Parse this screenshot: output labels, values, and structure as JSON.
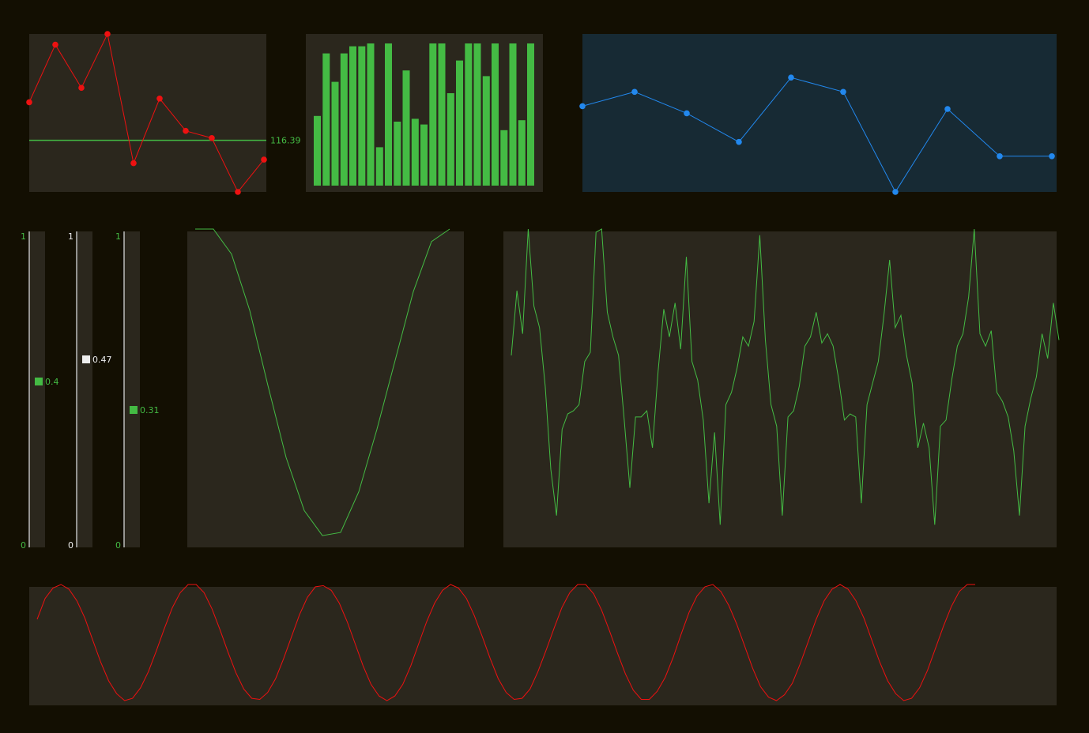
{
  "colors": {
    "background": "#130f02",
    "panel": "#2b271d",
    "panel_blue": "#172a34",
    "green": "#44bb44",
    "red": "#ee1111",
    "blue": "#2288ee",
    "white": "#eeeeee",
    "slider_track": "#bbbbbb"
  },
  "chart_data": [
    {
      "type": "line",
      "id": "red-markers",
      "x": [
        0,
        1,
        2,
        3,
        4,
        5,
        6,
        7,
        8,
        9
      ],
      "values": [
        127,
        143,
        131,
        146,
        110,
        128,
        119,
        117,
        102,
        111
      ],
      "ylim": [
        102,
        146
      ],
      "markers": true,
      "reference_line": {
        "value": 116.39,
        "label": "116.39"
      }
    },
    {
      "type": "bar",
      "id": "green-bars",
      "values": [
        0.49,
        0.93,
        0.73,
        0.93,
        0.98,
        0.98,
        1.0,
        0.27,
        1.0,
        0.45,
        0.81,
        0.47,
        0.43,
        1.0,
        1.0,
        0.65,
        0.88,
        1.0,
        1.0,
        0.77,
        1.0,
        0.39,
        1.0,
        0.46,
        1.0
      ],
      "ylim": [
        0,
        1
      ]
    },
    {
      "type": "line",
      "id": "blue-markers",
      "x": [
        0,
        1,
        2,
        3,
        4,
        5,
        6,
        7,
        8,
        9
      ],
      "values": [
        0.6,
        0.7,
        0.55,
        0.35,
        0.8,
        0.7,
        0.0,
        0.58,
        0.25,
        0.25
      ],
      "ylim": [
        0,
        1
      ],
      "markers": true
    },
    {
      "type": "line",
      "id": "valley-curve",
      "x": [
        0,
        1,
        2,
        3,
        4,
        5,
        6,
        7,
        8,
        9,
        10,
        11,
        12,
        13,
        14
      ],
      "values": [
        1.0,
        1.0,
        0.92,
        0.74,
        0.5,
        0.27,
        0.1,
        0.02,
        0.03,
        0.16,
        0.36,
        0.58,
        0.8,
        0.96,
        1.0
      ],
      "ylim": [
        0,
        1
      ]
    },
    {
      "type": "line",
      "id": "noisy-signal",
      "values": [
        0.59,
        0.8,
        0.66,
        1.0,
        0.75,
        0.68,
        0.49,
        0.22,
        0.07,
        0.35,
        0.4,
        0.41,
        0.43,
        0.57,
        0.6,
        0.99,
        1.0,
        0.73,
        0.65,
        0.59,
        0.38,
        0.16,
        0.39,
        0.39,
        0.41,
        0.29,
        0.54,
        0.74,
        0.65,
        0.76,
        0.61,
        0.91,
        0.57,
        0.51,
        0.38,
        0.11,
        0.34,
        0.04,
        0.43,
        0.47,
        0.55,
        0.65,
        0.62,
        0.7,
        0.98,
        0.64,
        0.43,
        0.36,
        0.07,
        0.39,
        0.41,
        0.49,
        0.62,
        0.65,
        0.73,
        0.63,
        0.66,
        0.62,
        0.51,
        0.38,
        0.4,
        0.39,
        0.11,
        0.43,
        0.5,
        0.57,
        0.72,
        0.9,
        0.68,
        0.72,
        0.59,
        0.5,
        0.29,
        0.37,
        0.29,
        0.04,
        0.36,
        0.38,
        0.51,
        0.62,
        0.66,
        0.78,
        1.0,
        0.66,
        0.62,
        0.67,
        0.47,
        0.44,
        0.39,
        0.28,
        0.07,
        0.36,
        0.45,
        0.52,
        0.66,
        0.58,
        0.76,
        0.64
      ],
      "ylim": [
        0,
        1
      ]
    },
    {
      "type": "line",
      "id": "red-sine",
      "values": [
        0.7,
        0.88,
        0.97,
        1.0,
        0.96,
        0.86,
        0.71,
        0.52,
        0.33,
        0.17,
        0.06,
        0.0,
        0.02,
        0.11,
        0.25,
        0.43,
        0.62,
        0.8,
        0.93,
        1.0,
        1.0,
        0.93,
        0.79,
        0.61,
        0.42,
        0.24,
        0.1,
        0.02,
        0.01,
        0.07,
        0.19,
        0.36,
        0.55,
        0.74,
        0.89,
        0.98,
        0.99,
        0.95,
        0.84,
        0.68,
        0.49,
        0.3,
        0.14,
        0.04,
        0.0,
        0.04,
        0.14,
        0.3,
        0.49,
        0.68,
        0.84,
        0.95,
        1.0,
        0.97,
        0.88,
        0.73,
        0.55,
        0.36,
        0.19,
        0.07,
        0.01,
        0.02,
        0.1,
        0.25,
        0.43,
        0.62,
        0.8,
        0.93,
        1.0,
        1.0,
        0.92,
        0.78,
        0.6,
        0.41,
        0.23,
        0.09,
        0.01,
        0.01,
        0.08,
        0.2,
        0.37,
        0.57,
        0.76,
        0.9,
        0.98,
        1.0,
        0.94,
        0.82,
        0.66,
        0.47,
        0.28,
        0.12,
        0.03,
        0.0,
        0.05,
        0.15,
        0.32,
        0.51,
        0.7,
        0.86,
        0.96,
        1.0,
        0.96,
        0.86,
        0.71,
        0.52,
        0.33,
        0.17,
        0.06,
        0.0,
        0.02,
        0.11,
        0.26,
        0.45,
        0.64,
        0.81,
        0.94,
        1.0,
        1.0
      ],
      "ylim": [
        0,
        1
      ]
    }
  ],
  "sliders": [
    {
      "name": "slider-a",
      "min_label": "0",
      "max_label": "1",
      "value": 0.4,
      "value_label": "0.4",
      "color": "#44bb44"
    },
    {
      "name": "slider-b",
      "min_label": "0",
      "max_label": "1",
      "value": 0.47,
      "value_label": "0.47",
      "color": "#eeeeee"
    },
    {
      "name": "slider-c",
      "min_label": "0",
      "max_label": "1",
      "value": 0.31,
      "value_label": "0.31",
      "color": "#44bb44"
    }
  ]
}
